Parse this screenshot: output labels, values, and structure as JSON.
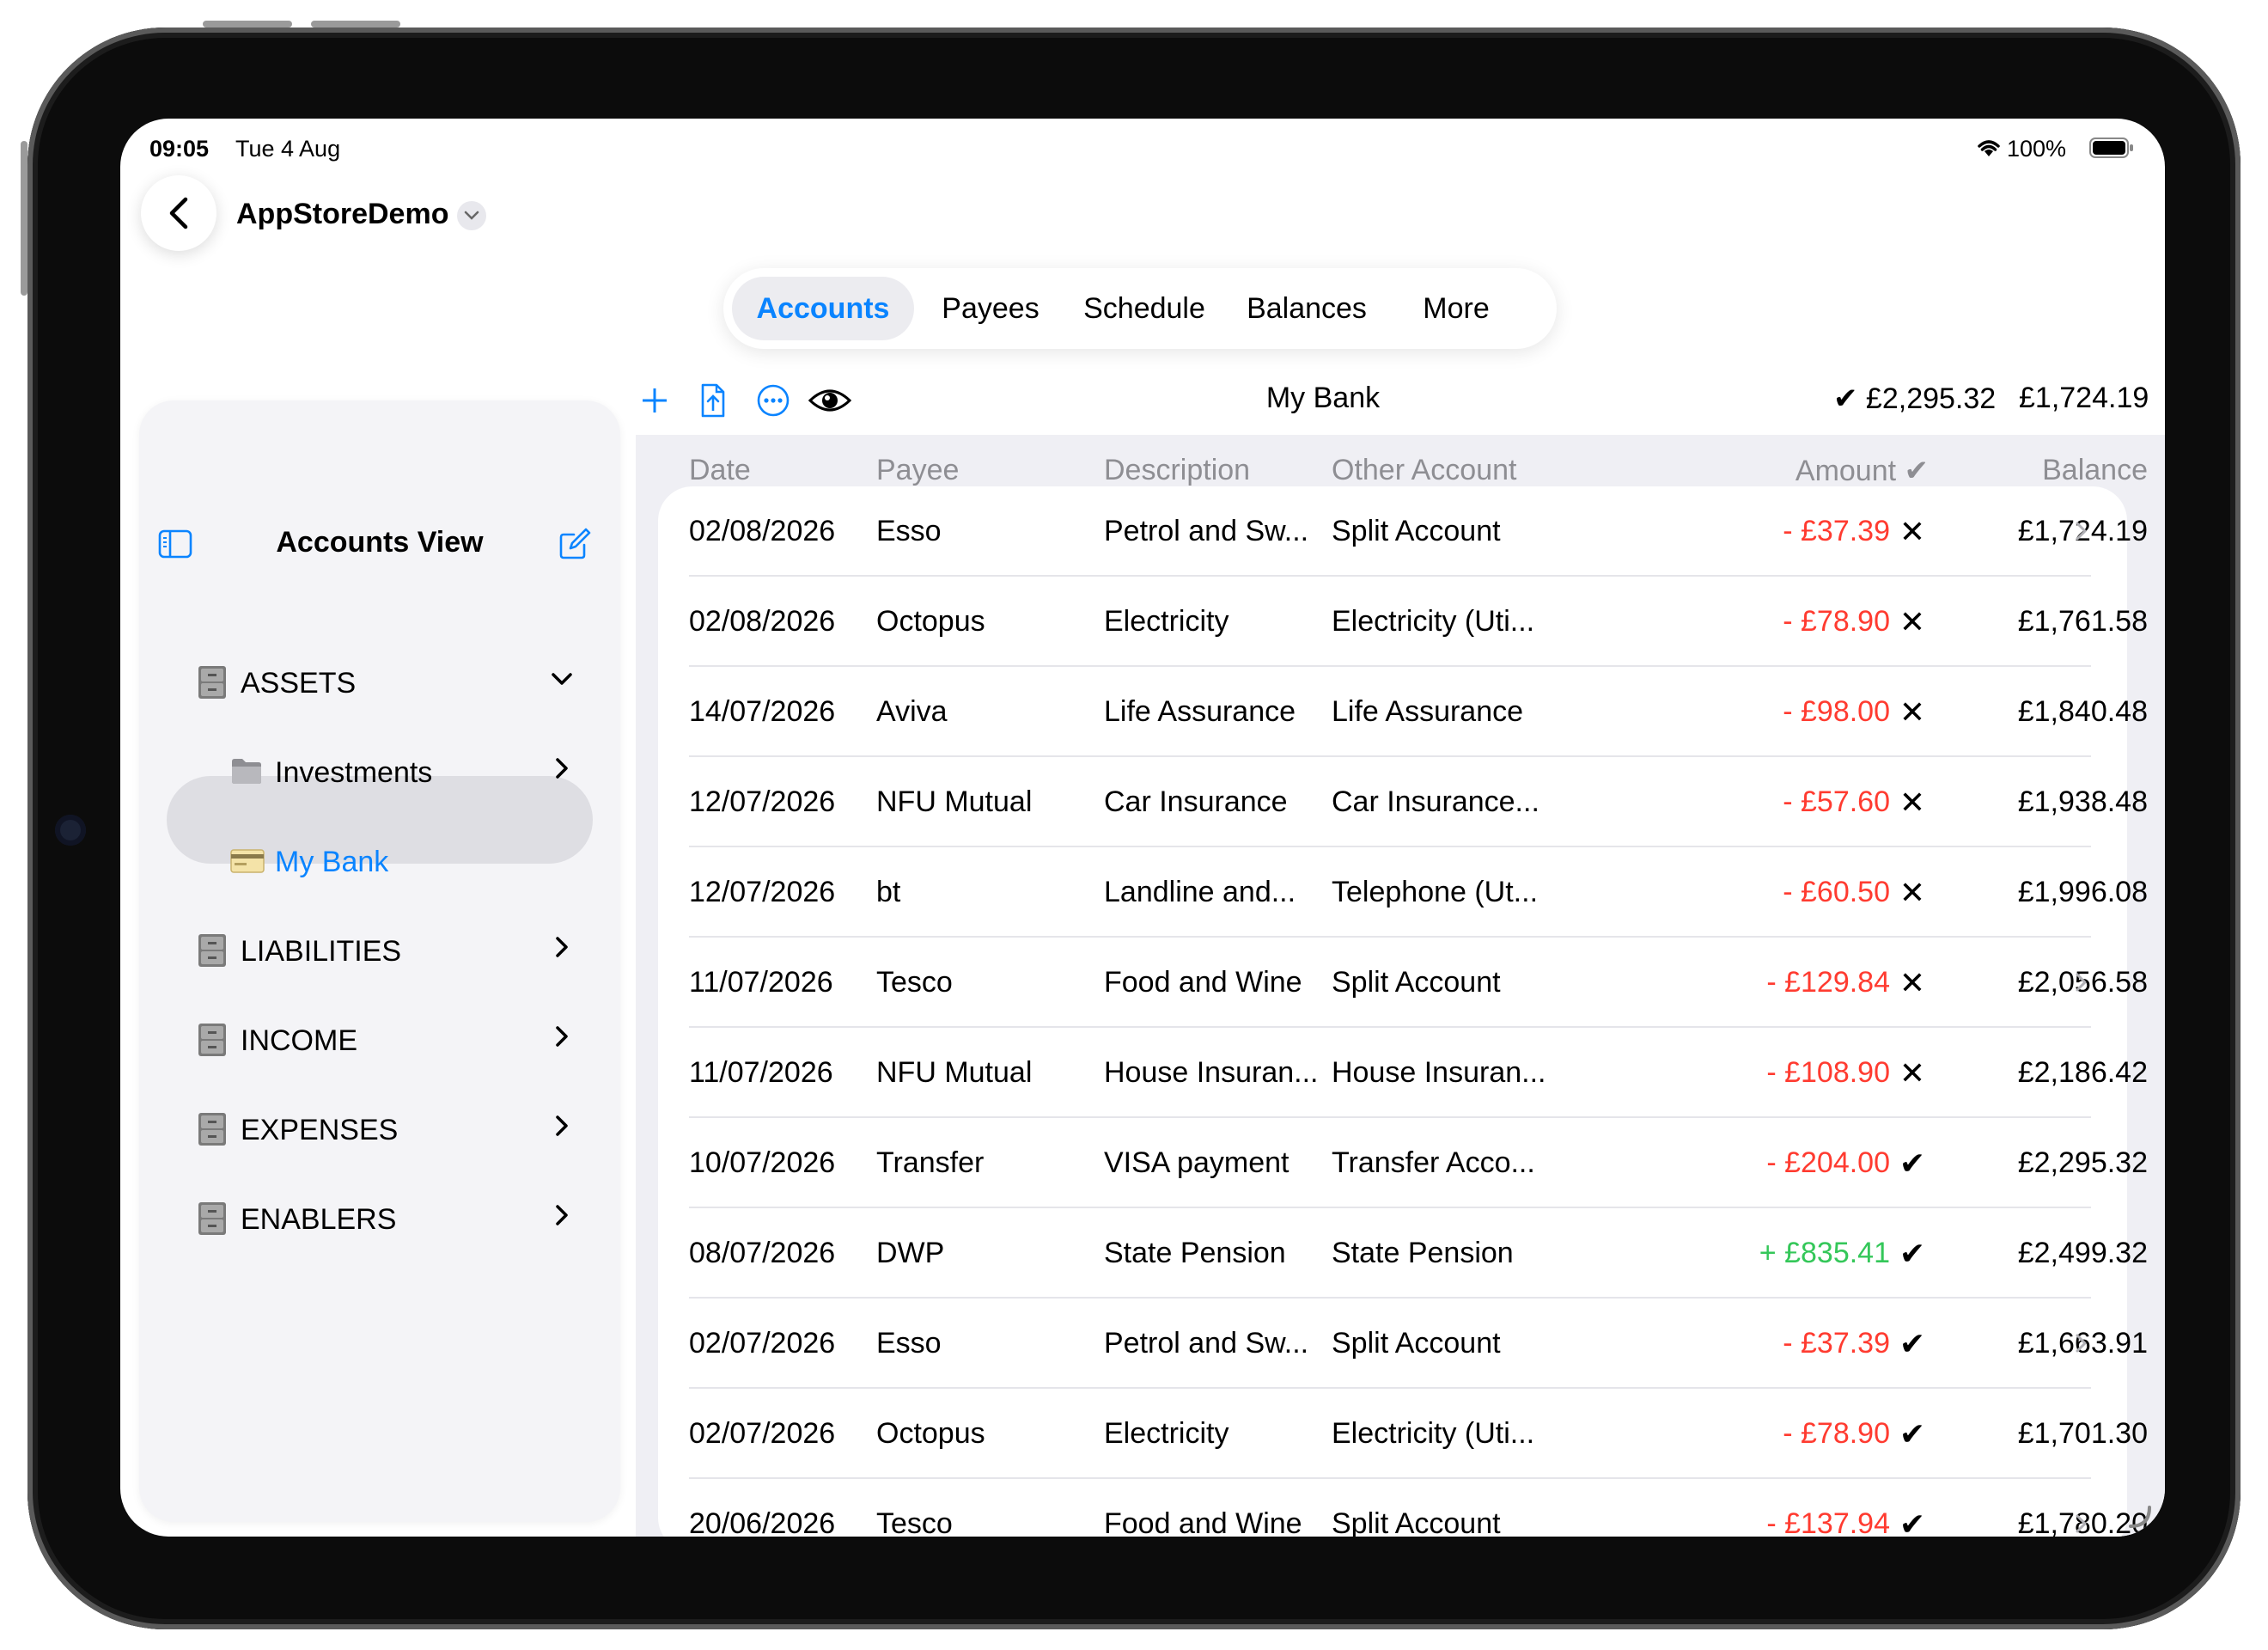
{
  "status": {
    "time": "09:05",
    "date": "Tue 4 Aug",
    "battery": "100%"
  },
  "header": {
    "title": "AppStoreDemo"
  },
  "tabs": [
    {
      "label": "Accounts",
      "active": true
    },
    {
      "label": "Payees",
      "active": false
    },
    {
      "label": "Schedule",
      "active": false
    },
    {
      "label": "Balances",
      "active": false
    },
    {
      "label": "More",
      "active": false
    }
  ],
  "sidebar": {
    "title": "Accounts View",
    "items": [
      {
        "label": "ASSETS",
        "icon": "cabinet-icon",
        "chevron": "down",
        "indent": 0,
        "selected": false
      },
      {
        "label": "Investments",
        "icon": "folder-icon",
        "chevron": "right",
        "indent": 1,
        "selected": false
      },
      {
        "label": "My Bank",
        "icon": "card-icon",
        "chevron": "none",
        "indent": 1,
        "selected": true
      },
      {
        "label": "LIABILITIES",
        "icon": "cabinet-icon",
        "chevron": "right",
        "indent": 0,
        "selected": false
      },
      {
        "label": "INCOME",
        "icon": "cabinet-icon",
        "chevron": "right",
        "indent": 0,
        "selected": false
      },
      {
        "label": "EXPENSES",
        "icon": "cabinet-icon",
        "chevron": "right",
        "indent": 0,
        "selected": false
      },
      {
        "label": "ENABLERS",
        "icon": "cabinet-icon",
        "chevron": "right",
        "indent": 0,
        "selected": false
      }
    ]
  },
  "account": {
    "name": "My Bank",
    "cleared_balance": "✔ £2,295.32",
    "balance": "£1,724.19"
  },
  "table": {
    "headers": {
      "date": "Date",
      "payee": "Payee",
      "description": "Description",
      "other": "Other Account",
      "amount": "Amount ✔",
      "balance": "Balance"
    },
    "rows": [
      {
        "date": "02/08/2026",
        "payee": "Esso",
        "description": "Petrol and Sw...",
        "other": "Split Account",
        "amount": "- £37.39",
        "sign": "neg",
        "status": "✕",
        "balance": "£1,724.19",
        "chevron": true
      },
      {
        "date": "02/08/2026",
        "payee": "Octopus",
        "description": "Electricity",
        "other": "Electricity (Uti...",
        "amount": "- £78.90",
        "sign": "neg",
        "status": "✕",
        "balance": "£1,761.58",
        "chevron": false
      },
      {
        "date": "14/07/2026",
        "payee": "Aviva",
        "description": "Life Assurance",
        "other": "Life Assurance",
        "amount": "- £98.00",
        "sign": "neg",
        "status": "✕",
        "balance": "£1,840.48",
        "chevron": false
      },
      {
        "date": "12/07/2026",
        "payee": "NFU Mutual",
        "description": "Car Insurance",
        "other": "Car Insurance...",
        "amount": "- £57.60",
        "sign": "neg",
        "status": "✕",
        "balance": "£1,938.48",
        "chevron": false
      },
      {
        "date": "12/07/2026",
        "payee": "bt",
        "description": "Landline and...",
        "other": "Telephone (Ut...",
        "amount": "- £60.50",
        "sign": "neg",
        "status": "✕",
        "balance": "£1,996.08",
        "chevron": false
      },
      {
        "date": "11/07/2026",
        "payee": "Tesco",
        "description": "Food and Wine",
        "other": "Split Account",
        "amount": "- £129.84",
        "sign": "neg",
        "status": "✕",
        "balance": "£2,056.58",
        "chevron": true
      },
      {
        "date": "11/07/2026",
        "payee": "NFU Mutual",
        "description": "House Insuran...",
        "other": "House Insuran...",
        "amount": "- £108.90",
        "sign": "neg",
        "status": "✕",
        "balance": "£2,186.42",
        "chevron": false
      },
      {
        "date": "10/07/2026",
        "payee": "Transfer",
        "description": "VISA payment",
        "other": "Transfer Acco...",
        "amount": "- £204.00",
        "sign": "neg",
        "status": "✔",
        "balance": "£2,295.32",
        "chevron": false
      },
      {
        "date": "08/07/2026",
        "payee": "DWP",
        "description": "State Pension",
        "other": "State Pension",
        "amount": "+ £835.41",
        "sign": "pos",
        "status": "✔",
        "balance": "£2,499.32",
        "chevron": false
      },
      {
        "date": "02/07/2026",
        "payee": "Esso",
        "description": "Petrol and Sw...",
        "other": "Split Account",
        "amount": "- £37.39",
        "sign": "neg",
        "status": "✔",
        "balance": "£1,663.91",
        "chevron": true
      },
      {
        "date": "02/07/2026",
        "payee": "Octopus",
        "description": "Electricity",
        "other": "Electricity (Uti...",
        "amount": "- £78.90",
        "sign": "neg",
        "status": "✔",
        "balance": "£1,701.30",
        "chevron": false
      },
      {
        "date": "20/06/2026",
        "payee": "Tesco",
        "description": "Food and Wine",
        "other": "Split Account",
        "amount": "- £137.94",
        "sign": "neg",
        "status": "✔",
        "balance": "£1,780.20",
        "chevron": true
      }
    ]
  },
  "colors": {
    "accent": "#0a84ff",
    "negative": "#ff3b30",
    "positive": "#34c759",
    "muted": "#8e8e93"
  }
}
